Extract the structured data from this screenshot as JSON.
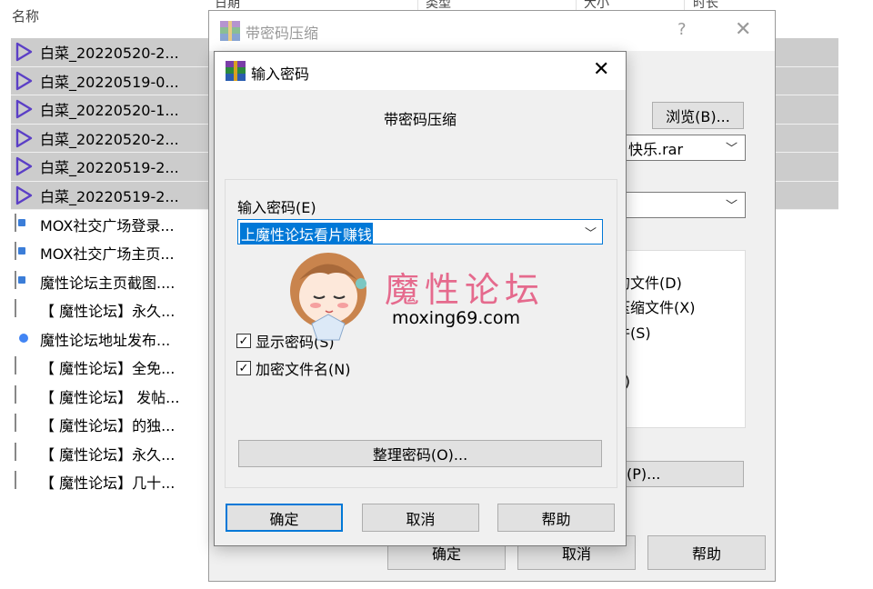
{
  "explorer": {
    "column_name": "名称",
    "column_fragments": [
      "日期",
      "类型",
      "大小",
      "时长"
    ],
    "files": [
      {
        "name": "白菜_20220520-2...",
        "icon": "video-icon",
        "selected": true
      },
      {
        "name": "白菜_20220519-0...",
        "icon": "video-icon",
        "selected": true
      },
      {
        "name": "白菜_20220520-1...",
        "icon": "video-icon",
        "selected": true
      },
      {
        "name": "白菜_20220520-2...",
        "icon": "video-icon",
        "selected": true
      },
      {
        "name": "白菜_20220519-2...",
        "icon": "video-icon",
        "selected": true
      },
      {
        "name": "白菜_20220519-2...",
        "icon": "video-icon",
        "selected": true
      },
      {
        "name": "MOX社交广场登录...",
        "icon": "image-file-icon",
        "selected": false
      },
      {
        "name": "MOX社交广场主页...",
        "icon": "image-file-icon",
        "selected": false
      },
      {
        "name": "魔性论坛主页截图....",
        "icon": "image-file-icon",
        "selected": false
      },
      {
        "name": "【 魔性论坛】永久...",
        "icon": "text-file-icon",
        "selected": false
      },
      {
        "name": "魔性论坛地址发布...",
        "icon": "chrome-icon",
        "selected": false
      },
      {
        "name": "【 魔性论坛】全免...",
        "icon": "text-file-icon",
        "selected": false
      },
      {
        "name": "【 魔性论坛】 发帖...",
        "icon": "text-file-icon",
        "selected": false
      },
      {
        "name": "【 魔性论坛】的独...",
        "icon": "text-file-icon",
        "selected": false
      },
      {
        "name": "【 魔性论坛】永久...",
        "icon": "text-file-icon",
        "selected": false
      },
      {
        "name": "【 魔性论坛】几十...",
        "icon": "text-file-icon",
        "selected": false
      }
    ]
  },
  "back_dialog": {
    "title": "带密码压缩",
    "help": "?",
    "close": "✕",
    "browse_button": "浏览(B)...",
    "archive_name": "快乐.rar",
    "options_fragments": [
      "的文件(D)",
      "压缩文件(X)",
      "件(S)",
      "T)"
    ],
    "partial_button": "(P)...",
    "ok_button": "确定",
    "cancel_button": "取消",
    "help_button": "帮助"
  },
  "front_dialog": {
    "title": "输入密码",
    "close": "✕",
    "heading": "带密码压缩",
    "password_label": "输入密码(E)",
    "password_value": "上魔性论坛看片赚钱",
    "show_password_label": "显示密码(S)",
    "show_password_checked": true,
    "encrypt_names_label": "加密文件名(N)",
    "encrypt_names_checked": true,
    "organize_button": "整理密码(O)...",
    "ok_button": "确定",
    "cancel_button": "取消",
    "help_button": "帮助"
  },
  "watermark": {
    "title": "魔性论坛",
    "url": "moxing69.com"
  },
  "colors": {
    "accent": "#0078d7",
    "selection": "#cccccc",
    "dialog_bg": "#f0f0f0",
    "watermark_pink": "#e56a8d"
  }
}
